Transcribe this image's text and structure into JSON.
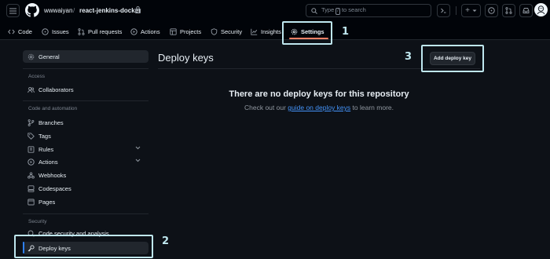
{
  "header": {
    "owner": "wwwaiyan",
    "separator": "/",
    "repo": "react-jenkins-docker",
    "search_placeholder_pre": "Type",
    "search_key": "/",
    "search_placeholder_post": "to search",
    "new_button_label": "+"
  },
  "nav": {
    "tabs": [
      {
        "label": "Code",
        "icon": "code-icon"
      },
      {
        "label": "Issues",
        "icon": "issue-icon"
      },
      {
        "label": "Pull requests",
        "icon": "pull-request-icon"
      },
      {
        "label": "Actions",
        "icon": "play-icon"
      },
      {
        "label": "Projects",
        "icon": "table-icon"
      },
      {
        "label": "Security",
        "icon": "shield-icon"
      },
      {
        "label": "Insights",
        "icon": "graph-icon"
      },
      {
        "label": "Settings",
        "icon": "gear-icon",
        "active": true
      }
    ]
  },
  "sidebar": {
    "general": "General",
    "section_access": "Access",
    "collaborators": "Collaborators",
    "section_code": "Code and automation",
    "branches": "Branches",
    "tags": "Tags",
    "rules": "Rules",
    "actions": "Actions",
    "webhooks": "Webhooks",
    "codespaces": "Codespaces",
    "pages": "Pages",
    "section_security": "Security",
    "code_security": "Code security and analysis",
    "deploy_keys": "Deploy keys"
  },
  "main": {
    "title": "Deploy keys",
    "add_button": "Add deploy key",
    "empty_title": "There are no deploy keys for this repository",
    "empty_pre": "Check out our",
    "empty_link": "guide on deploy keys",
    "empty_post": "to learn more."
  },
  "annotations": {
    "one": "1",
    "two": "2",
    "three": "3"
  },
  "colors": {
    "background": "#0d1117",
    "header": "#010409",
    "accent": "#f78166",
    "link": "#4493f8",
    "selection": "#2f81f7",
    "annotation": "#bfe7ef"
  }
}
